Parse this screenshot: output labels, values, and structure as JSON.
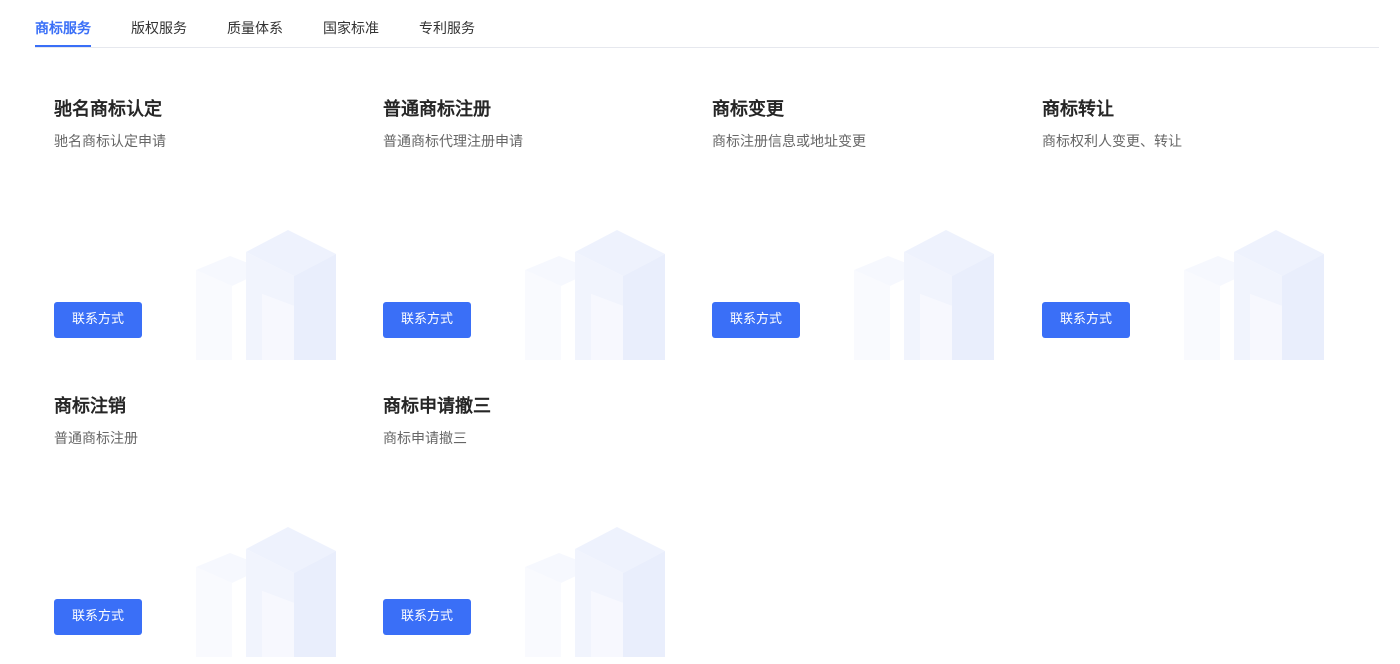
{
  "tabs": [
    {
      "label": "商标服务",
      "active": true
    },
    {
      "label": "版权服务",
      "active": false
    },
    {
      "label": "质量体系",
      "active": false
    },
    {
      "label": "国家标准",
      "active": false
    },
    {
      "label": "专利服务",
      "active": false
    }
  ],
  "colors": {
    "accent": "#3a6ff7",
    "title": "#262626",
    "desc": "#666666",
    "decoration": "#edf1fd"
  },
  "cards": [
    {
      "title": "驰名商标认定",
      "desc": "驰名商标认定申请",
      "button_label": "联系方式"
    },
    {
      "title": "普通商标注册",
      "desc": "普通商标代理注册申请",
      "button_label": "联系方式"
    },
    {
      "title": "商标变更",
      "desc": "商标注册信息或地址变更",
      "button_label": "联系方式"
    },
    {
      "title": "商标转让",
      "desc": "商标权利人变更、转让",
      "button_label": "联系方式"
    },
    {
      "title": "商标注销",
      "desc": "普通商标注册",
      "button_label": "联系方式"
    },
    {
      "title": "商标申请撤三",
      "desc": "商标申请撤三",
      "button_label": "联系方式"
    }
  ]
}
